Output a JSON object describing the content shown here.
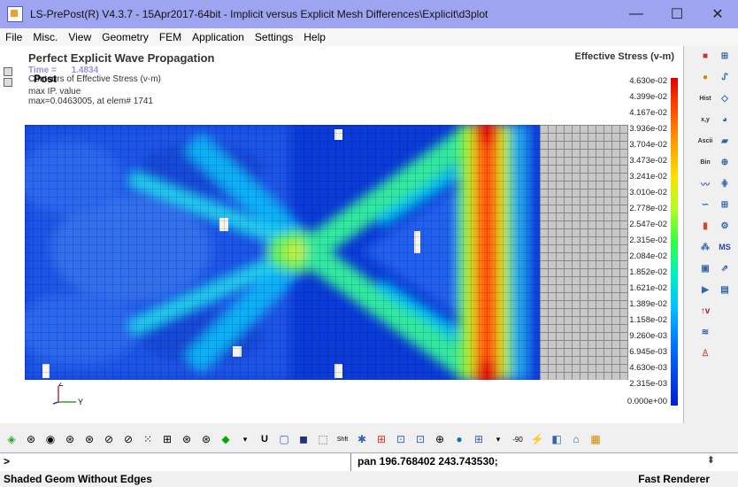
{
  "window": {
    "title": "LS-PrePost(R) V4.3.7 - 15Apr2017-64bit  - Implicit versus Explicit Mesh Differences\\Explicit\\d3plot",
    "minimize": "—",
    "maximize": "☐",
    "close": "✕"
  },
  "menu": [
    "File",
    "Misc.",
    "View",
    "Geometry",
    "FEM",
    "Application",
    "Settings",
    "Help"
  ],
  "viewport": {
    "title": "Perfect Explicit Wave Propagation",
    "time_label": "Time =",
    "time_value": "1.4834",
    "contours": "Contours of Effective Stress (v-m)",
    "post": "Post",
    "max_ip": "max IP. value",
    "max_text": "max=0.0463005, at elem# 1741"
  },
  "legend": {
    "title": "Effective Stress (v-m)",
    "labels": [
      "4.630e-02",
      "4.399e-02",
      "4.167e-02",
      "3.936e-02",
      "3.704e-02",
      "3.473e-02",
      "3.241e-02",
      "3.010e-02",
      "2.778e-02",
      "2.547e-02",
      "2.315e-02",
      "2.084e-02",
      "1.852e-02",
      "1.621e-02",
      "1.389e-02",
      "1.158e-02",
      "9.260e-03",
      "6.945e-03",
      "4.630e-03",
      "2.315e-03",
      "0.000e+00"
    ]
  },
  "triad": {
    "z": "Z",
    "y": "Y"
  },
  "command": {
    "prompt": ">",
    "pan": "pan 196.768402 243.743530;"
  },
  "status": {
    "left": "Shaded Geom Without Edges",
    "right": "Fast Renderer"
  },
  "colors": {
    "titlebar": "#9fa4f0",
    "legend_top": "#e00000",
    "legend_bottom": "#0020d0"
  }
}
